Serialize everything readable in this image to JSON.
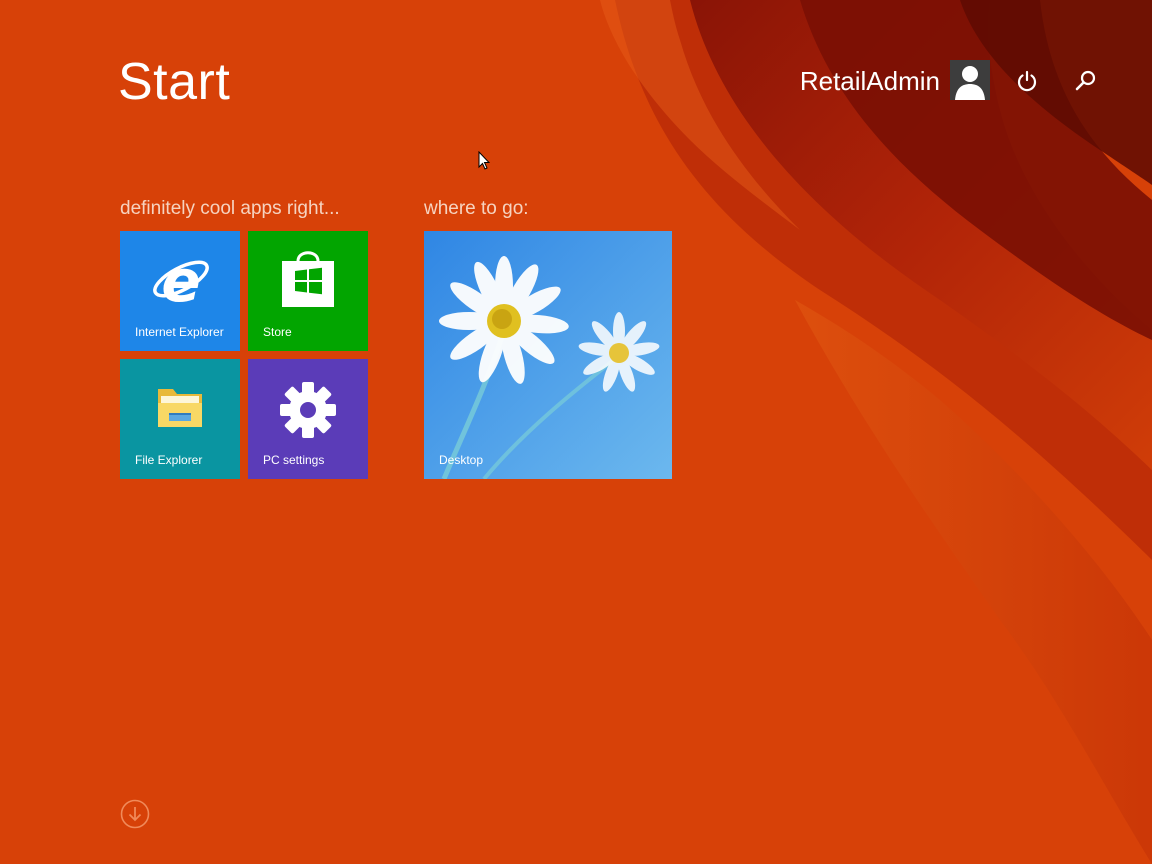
{
  "header": {
    "title": "Start",
    "user_name": "RetailAdmin",
    "avatar_icon": "user-avatar-icon",
    "power_icon": "power-icon",
    "search_icon": "search-icon"
  },
  "colors": {
    "background": "#d74108",
    "ie_tile": "#1e86e8",
    "store_tile": "#02a500",
    "file_explorer_tile": "#0a95a1",
    "pc_settings_tile": "#5b3cb8",
    "desktop_tile": "#3a90e0"
  },
  "groups": [
    {
      "title": "definitely cool apps right...",
      "tiles": [
        {
          "label": "Internet Explorer",
          "icon": "internet-explorer-icon"
        },
        {
          "label": "Store",
          "icon": "store-icon"
        },
        {
          "label": "File Explorer",
          "icon": "file-explorer-icon"
        },
        {
          "label": "PC settings",
          "icon": "gear-icon"
        }
      ]
    },
    {
      "title": "where to go:",
      "tiles": [
        {
          "label": "Desktop",
          "icon": "desktop-daisy-wallpaper"
        }
      ]
    }
  ],
  "footer": {
    "scroll_icon": "arrow-down-circle-icon"
  }
}
